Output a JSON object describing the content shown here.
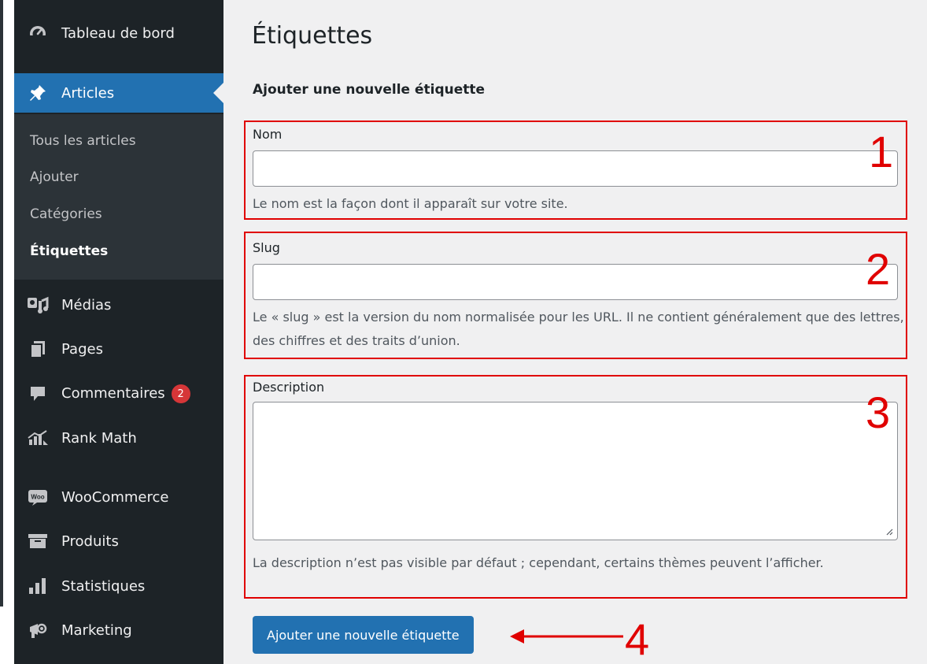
{
  "sidebar": {
    "top_items": [
      {
        "label": "Tableau de bord",
        "icon": "dashboard-icon"
      },
      {
        "label": "Articles",
        "icon": "pin-icon",
        "active": true
      }
    ],
    "submenu": [
      "Tous les articles",
      "Ajouter",
      "Catégories",
      "Étiquettes"
    ],
    "current_submenu": "Étiquettes",
    "items": [
      {
        "label": "Médias",
        "icon": "media-icon"
      },
      {
        "label": "Pages",
        "icon": "pages-icon"
      },
      {
        "label": "Commentaires",
        "icon": "comments-icon",
        "badge": "2"
      },
      {
        "label": "Rank Math",
        "icon": "rank-math-icon"
      },
      {
        "label": "WooCommerce",
        "icon": "woocommerce-icon"
      },
      {
        "label": "Produits",
        "icon": "products-icon"
      },
      {
        "label": "Statistiques",
        "icon": "statistics-icon"
      },
      {
        "label": "Marketing",
        "icon": "marketing-icon"
      }
    ]
  },
  "main": {
    "title": "Étiquettes",
    "section_title": "Ajouter une nouvelle étiquette",
    "fields": {
      "name": {
        "label": "Nom",
        "value": "",
        "help": "Le nom est la façon dont il apparaît sur votre site.",
        "marker": "1"
      },
      "slug": {
        "label": "Slug",
        "value": "",
        "help": "Le « slug » est la version du nom normalisée pour les URL. Il ne contient généralement que des lettres, des chiffres et des traits d’union.",
        "marker": "2"
      },
      "description": {
        "label": "Description",
        "value": "",
        "help": "La description n’est pas visible par défaut ; cependant, certains thèmes peuvent l’afficher.",
        "marker": "3"
      }
    },
    "submit_label": "Ajouter une nouvelle étiquette",
    "submit_marker": "4"
  },
  "colors": {
    "sidebar_bg": "#1d2327",
    "accent": "#2271b1",
    "annotation": "#e00000",
    "badge": "#d63638",
    "main_bg": "#f0f0f1"
  }
}
